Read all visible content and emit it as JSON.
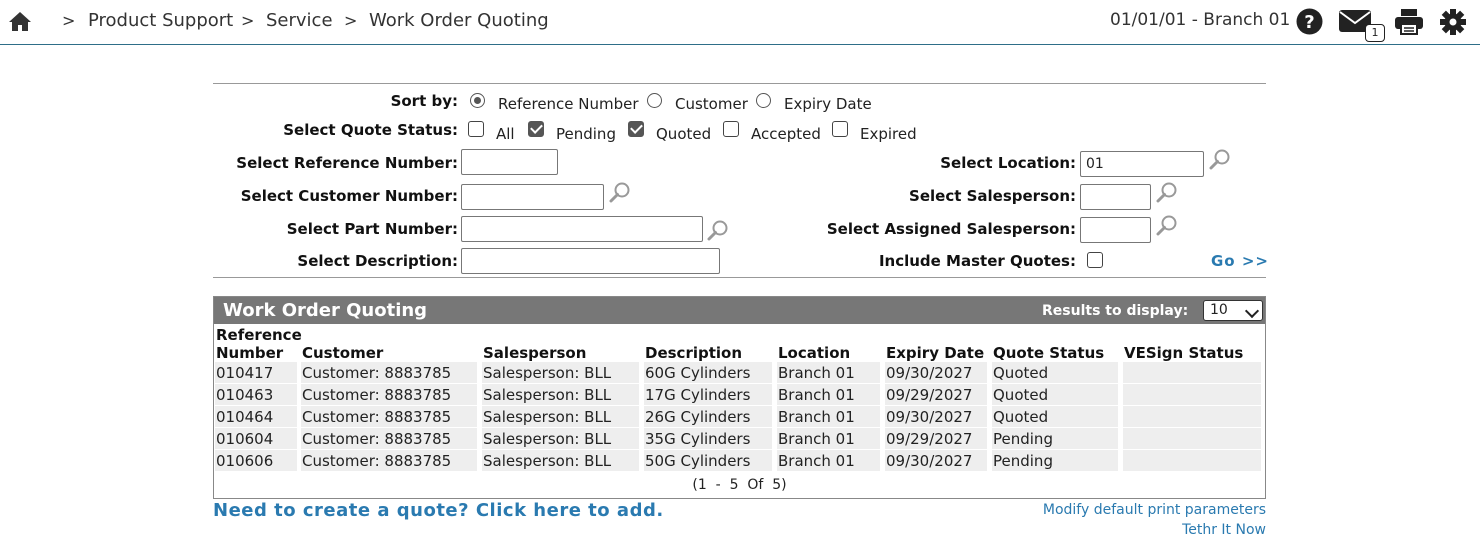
{
  "breadcrumb": {
    "items": [
      "Product Support",
      "Service",
      "Work Order Quoting"
    ],
    "separator": ">"
  },
  "header": {
    "branch_text": "01/01/01 - Branch 01",
    "mail_count": "1"
  },
  "filters": {
    "sort_label": "Sort by:",
    "sort_options": [
      "Reference Number",
      "Customer",
      "Expiry Date"
    ],
    "sort_selected": "Reference Number",
    "status_label": "Select Quote Status:",
    "status_options": [
      {
        "label": "All",
        "checked": false
      },
      {
        "label": "Pending",
        "checked": true
      },
      {
        "label": "Quoted",
        "checked": true
      },
      {
        "label": "Accepted",
        "checked": false
      },
      {
        "label": "Expired",
        "checked": false
      }
    ],
    "ref_label": "Select Reference Number:",
    "ref_value": "",
    "customer_label": "Select Customer Number:",
    "customer_value": "",
    "part_label": "Select Part Number:",
    "part_value": "",
    "desc_label": "Select Description:",
    "desc_value": "",
    "location_label": "Select Location:",
    "location_value": "01",
    "salesperson_label": "Select Salesperson:",
    "salesperson_value": "",
    "assigned_label": "Select Assigned Salesperson:",
    "assigned_value": "",
    "master_label": "Include Master Quotes:",
    "master_checked": false,
    "go_label": "Go >>"
  },
  "results": {
    "title": "Work Order Quoting",
    "display_label": "Results to display:",
    "display_value": "10",
    "columns": {
      "ref_line1": "Reference",
      "ref_line2": "Number",
      "customer": "Customer",
      "salesperson": "Salesperson",
      "description": "Description",
      "location": "Location",
      "expiry": "Expiry Date",
      "status": "Quote Status",
      "vesign": "VESign Status"
    },
    "rows": [
      {
        "ref": "010417",
        "customer": "Customer: 8883785",
        "salesperson": "Salesperson: BLL",
        "description": "60G Cylinders",
        "location": "Branch 01",
        "expiry": "09/30/2027",
        "status": "Quoted",
        "vesign": ""
      },
      {
        "ref": "010463",
        "customer": "Customer: 8883785",
        "salesperson": "Salesperson: BLL",
        "description": "17G Cylinders",
        "location": "Branch 01",
        "expiry": "09/29/2027",
        "status": "Quoted",
        "vesign": ""
      },
      {
        "ref": "010464",
        "customer": "Customer: 8883785",
        "salesperson": "Salesperson: BLL",
        "description": "26G Cylinders",
        "location": "Branch 01",
        "expiry": "09/30/2027",
        "status": "Quoted",
        "vesign": ""
      },
      {
        "ref": "010604",
        "customer": "Customer: 8883785",
        "salesperson": "Salesperson: BLL",
        "description": "35G Cylinders",
        "location": "Branch 01",
        "expiry": "09/29/2027",
        "status": "Pending",
        "vesign": ""
      },
      {
        "ref": "010606",
        "customer": "Customer: 8883785",
        "salesperson": "Salesperson: BLL",
        "description": "50G Cylinders",
        "location": "Branch 01",
        "expiry": "09/30/2027",
        "status": "Pending",
        "vesign": ""
      }
    ],
    "pager": "(1  -  5  Of  5)"
  },
  "footer": {
    "create_link": "Need to create a quote? Click here to add.",
    "print_params_link": "Modify default print parameters",
    "tethr_link": "Tethr It Now"
  },
  "colors": {
    "link": "#2a7ab0",
    "panel_header": "#777777",
    "row_bg": "#eeeeee",
    "topbar_border": "#2e6e88"
  }
}
